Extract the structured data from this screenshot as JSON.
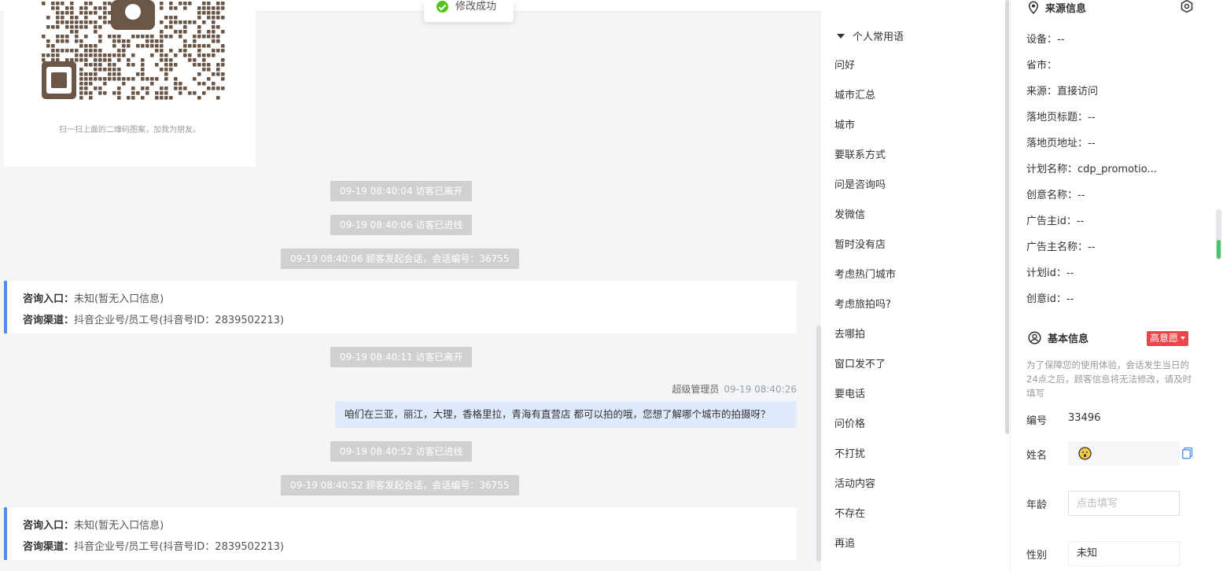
{
  "toast": {
    "text": "修改成功",
    "icon": "check-circle-icon"
  },
  "chat": {
    "qr_caption": "扫一扫上面的二维码图案，加我为朋友。",
    "events_1": [
      "09-19 08:40:04 访客已离开",
      "09-19 08:40:06 访客已进线",
      "09-19 08:40:06 顾客发起会话，会话编号：36755"
    ],
    "consult_1": {
      "entry_label": "咨询入口：",
      "entry_value": "未知(暂无入口信息)",
      "channel_label": "咨询渠道：",
      "channel_value": "抖音企业号/员工号(抖音号ID：2839502213)"
    },
    "event_leave_2": "09-19 08:40:11 访客已离开",
    "message": {
      "sender": "超级管理员",
      "time": "09-19 08:40:26",
      "text": "咱们在三亚，丽江，大理，香格里拉，青海有直营店 都可以拍的哦，您想了解哪个城市的拍摄呀？"
    },
    "events_2": [
      "09-19 08:40:52 访客已进线",
      "09-19 08:40:52 顾客发起会话，会话编号：36755"
    ],
    "consult_2": {
      "entry_label": "咨询入口：",
      "entry_value": "未知(暂无入口信息)",
      "channel_label": "咨询渠道：",
      "channel_value": "抖音企业号/员工号(抖音号ID：2839502213)"
    }
  },
  "phrases": {
    "group_title": "个人常用语",
    "items": [
      "问好",
      "城市汇总",
      "城市",
      "要联系方式",
      "问是咨询吗",
      "发微信",
      "暂时没有店",
      "考虑热门城市",
      "考虑旅拍吗?",
      "去哪拍",
      "窗口发不了",
      "要电话",
      "问价格",
      "不打扰",
      "活动内容",
      "不存在",
      "再追"
    ]
  },
  "source": {
    "title": "来源信息",
    "rows": [
      {
        "label": "设备：",
        "value": "--"
      },
      {
        "label": "省市：",
        "value": ""
      },
      {
        "label": "来源：",
        "value": "直接访问"
      },
      {
        "label": "落地页标题：",
        "value": "--"
      },
      {
        "label": "落地页地址：",
        "value": "--"
      },
      {
        "label": "计划名称：",
        "value": "cdp_promotio..."
      },
      {
        "label": "创意名称：",
        "value": "--"
      },
      {
        "label": "广告主id：",
        "value": "--"
      },
      {
        "label": "广告主名称：",
        "value": "--"
      },
      {
        "label": "计划id：",
        "value": "--"
      },
      {
        "label": "创意id：",
        "value": "--"
      }
    ]
  },
  "basic": {
    "title": "基本信息",
    "intent": "高意愿",
    "note": "为了保障您的使用体验，会话发生当日的24点之后，顾客信息将无法修改，请及时填写",
    "id_label": "编号",
    "id_value": "33496",
    "name_label": "姓名",
    "age_label": "年龄",
    "age_placeholder": "点击填写",
    "gender_label": "性别",
    "gender_value": "未知"
  },
  "colors": {
    "accent_blue": "#4b8ef2",
    "intent_red": "#f0444b",
    "success_green": "#52c41a",
    "bubble_blue": "#dfeafd"
  }
}
